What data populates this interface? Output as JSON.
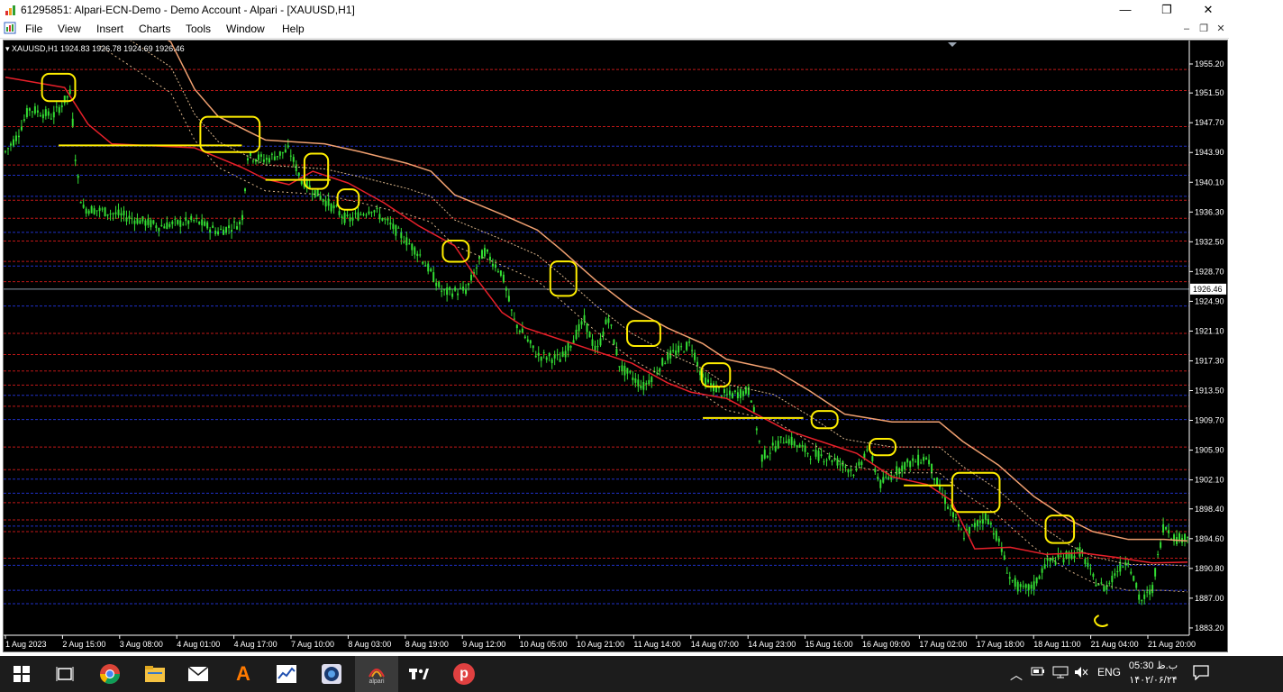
{
  "window": {
    "title": "61295851: Alpari-ECN-Demo - Demo Account - Alpari - [XAUUSD,H1]",
    "minimize": "—",
    "maximize": "❐",
    "close": "✕"
  },
  "menu": {
    "items": [
      "File",
      "View",
      "Insert",
      "Charts",
      "Tools",
      "Window",
      "Help"
    ],
    "mdi_minimize": "–",
    "mdi_restore": "❐",
    "mdi_close": "✕"
  },
  "chart": {
    "header": "XAUUSD,H1  1924.83 1926.78 1924.69 1926.46",
    "symbol": "XAUUSD",
    "timeframe": "H1",
    "current_price": "1926.46",
    "colors": {
      "background": "#000000",
      "candles": "#33dd33",
      "red_line": "#e8202a",
      "orange_line": "#f0a070",
      "dotted_line": "#d9b48a",
      "red_levels": "#c01818",
      "blue_levels": "#2030c8",
      "annotations": "#ffee00",
      "axis_text": "#ffffff"
    }
  },
  "chart_data": {
    "type": "candlestick",
    "price_ticks": [
      "1955.20",
      "1951.50",
      "1947.70",
      "1943.90",
      "1940.10",
      "1936.30",
      "1932.50",
      "1928.70",
      "1924.90",
      "1921.10",
      "1917.30",
      "1913.50",
      "1909.70",
      "1905.90",
      "1902.10",
      "1898.40",
      "1894.60",
      "1890.80",
      "1887.00",
      "1883.20"
    ],
    "time_ticks": [
      "1 Aug 2023",
      "2 Aug 15:00",
      "3 Aug 08:00",
      "4 Aug 01:00",
      "4 Aug 17:00",
      "7 Aug 10:00",
      "8 Aug 03:00",
      "8 Aug 19:00",
      "9 Aug 12:00",
      "10 Aug 05:00",
      "10 Aug 21:00",
      "11 Aug 14:00",
      "14 Aug 07:00",
      "14 Aug 23:00",
      "15 Aug 16:00",
      "16 Aug 09:00",
      "17 Aug 02:00",
      "17 Aug 18:00",
      "18 Aug 11:00",
      "21 Aug 04:00",
      "21 Aug 20:00"
    ],
    "ylim": [
      1882.5,
      1957.5
    ],
    "price_path": [
      [
        0,
        1944.0
      ],
      [
        0.01,
        1946
      ],
      [
        0.02,
        1949.5
      ],
      [
        0.04,
        1948.5
      ],
      [
        0.05,
        1950.5
      ],
      [
        0.055,
        1951.5
      ],
      [
        0.06,
        1942.0
      ],
      [
        0.065,
        1936.8
      ],
      [
        0.08,
        1936.5
      ],
      [
        0.1,
        1935.8
      ],
      [
        0.13,
        1934.5
      ],
      [
        0.16,
        1935.2
      ],
      [
        0.18,
        1933.8
      ],
      [
        0.2,
        1935.0
      ],
      [
        0.205,
        1943.5
      ],
      [
        0.22,
        1943.0
      ],
      [
        0.24,
        1944.2
      ],
      [
        0.25,
        1940.5
      ],
      [
        0.27,
        1937.8
      ],
      [
        0.29,
        1935.2
      ],
      [
        0.31,
        1936.8
      ],
      [
        0.33,
        1934.0
      ],
      [
        0.35,
        1931.0
      ],
      [
        0.37,
        1926.0
      ],
      [
        0.39,
        1926.3
      ],
      [
        0.405,
        1931.4
      ],
      [
        0.42,
        1928.5
      ],
      [
        0.43,
        1922.5
      ],
      [
        0.45,
        1918.0
      ],
      [
        0.47,
        1917.5
      ],
      [
        0.49,
        1922.5
      ],
      [
        0.5,
        1918.2
      ],
      [
        0.51,
        1923.0
      ],
      [
        0.52,
        1916.5
      ],
      [
        0.54,
        1914.0
      ],
      [
        0.56,
        1917.8
      ],
      [
        0.58,
        1919.5
      ],
      [
        0.59,
        1915.0
      ],
      [
        0.61,
        1912.8
      ],
      [
        0.63,
        1913.5
      ],
      [
        0.64,
        1905.0
      ],
      [
        0.66,
        1907.5
      ],
      [
        0.68,
        1905.5
      ],
      [
        0.7,
        1904.8
      ],
      [
        0.72,
        1903.0
      ],
      [
        0.73,
        1906.5
      ],
      [
        0.74,
        1901.5
      ],
      [
        0.76,
        1904.0
      ],
      [
        0.78,
        1905.0
      ],
      [
        0.79,
        1901.0
      ],
      [
        0.8,
        1898.0
      ],
      [
        0.81,
        1895.0
      ],
      [
        0.83,
        1897.5
      ],
      [
        0.84,
        1894.5
      ],
      [
        0.85,
        1889.5
      ],
      [
        0.86,
        1888.0
      ],
      [
        0.87,
        1888.5
      ],
      [
        0.88,
        1891.5
      ],
      [
        0.9,
        1892.5
      ],
      [
        0.91,
        1893.0
      ],
      [
        0.92,
        1889.5
      ],
      [
        0.93,
        1888.2
      ],
      [
        0.94,
        1890.5
      ],
      [
        0.95,
        1892.0
      ],
      [
        0.96,
        1886.5
      ],
      [
        0.97,
        1888.0
      ],
      [
        0.98,
        1896.5
      ],
      [
        0.99,
        1894.5
      ],
      [
        1.0,
        1895.0
      ]
    ],
    "red_line_path": [
      [
        0,
        1953.5
      ],
      [
        0.05,
        1952.2
      ],
      [
        0.07,
        1947.5
      ],
      [
        0.09,
        1945.0
      ],
      [
        0.16,
        1944.5
      ],
      [
        0.2,
        1942.0
      ],
      [
        0.22,
        1940.5
      ],
      [
        0.24,
        1939.8
      ],
      [
        0.26,
        1941.5
      ],
      [
        0.29,
        1940.0
      ],
      [
        0.32,
        1937.5
      ],
      [
        0.35,
        1934.5
      ],
      [
        0.38,
        1932.0
      ],
      [
        0.4,
        1927.5
      ],
      [
        0.42,
        1923.5
      ],
      [
        0.44,
        1921.5
      ],
      [
        0.47,
        1920.0
      ],
      [
        0.5,
        1918.5
      ],
      [
        0.53,
        1917.0
      ],
      [
        0.56,
        1914.5
      ],
      [
        0.58,
        1913.3
      ],
      [
        0.61,
        1912.5
      ],
      [
        0.66,
        1908.5
      ],
      [
        0.69,
        1907.0
      ],
      [
        0.72,
        1905.5
      ],
      [
        0.75,
        1902.5
      ],
      [
        0.78,
        1901.5
      ],
      [
        0.8,
        1899.5
      ],
      [
        0.82,
        1893.3
      ],
      [
        0.85,
        1893.5
      ],
      [
        0.88,
        1892.6
      ],
      [
        0.91,
        1892.8
      ],
      [
        0.94,
        1892.2
      ],
      [
        0.97,
        1891.5
      ],
      [
        1.0,
        1891.6
      ]
    ],
    "orange_line_path": [
      [
        0.08,
        1964.0
      ],
      [
        0.14,
        1958.0
      ],
      [
        0.16,
        1952.0
      ],
      [
        0.18,
        1948.5
      ],
      [
        0.22,
        1945.5
      ],
      [
        0.27,
        1945.0
      ],
      [
        0.3,
        1944.0
      ],
      [
        0.34,
        1942.5
      ],
      [
        0.36,
        1941.5
      ],
      [
        0.38,
        1938.5
      ],
      [
        0.42,
        1936.0
      ],
      [
        0.45,
        1934.0
      ],
      [
        0.47,
        1931.5
      ],
      [
        0.5,
        1927.5
      ],
      [
        0.53,
        1924.0
      ],
      [
        0.56,
        1921.5
      ],
      [
        0.59,
        1919.5
      ],
      [
        0.61,
        1917.5
      ],
      [
        0.65,
        1916.2
      ],
      [
        0.68,
        1913.5
      ],
      [
        0.71,
        1910.5
      ],
      [
        0.75,
        1909.5
      ],
      [
        0.79,
        1909.5
      ],
      [
        0.81,
        1907.0
      ],
      [
        0.84,
        1904.0
      ],
      [
        0.87,
        1900.0
      ],
      [
        0.9,
        1897.0
      ],
      [
        0.92,
        1895.5
      ],
      [
        0.95,
        1894.5
      ],
      [
        0.98,
        1894.5
      ],
      [
        1.0,
        1894.3
      ]
    ],
    "red_levels": [
      1954.5,
      1951.8,
      1947.2,
      1942.3,
      1937.8,
      1935.5,
      1932.6,
      1930.0,
      1927.4,
      1920.8,
      1918.1,
      1916.0,
      1914.2,
      1911.5,
      1906.3,
      1903.4,
      1899.2,
      1897.0,
      1895.5,
      1892.1
    ],
    "blue_levels": [
      1944.7,
      1941.0,
      1938.3,
      1933.7,
      1929.4,
      1924.3,
      1912.9,
      1909.8,
      1902.2,
      1900.4,
      1896.2,
      1891.2,
      1888.0,
      1886.3
    ],
    "current_price_level": 1926.46
  },
  "taskbar": {
    "icons": [
      "windows-start",
      "task-view",
      "chrome",
      "file-explorer",
      "mail",
      "avast",
      "app-chart",
      "app-media",
      "alpari",
      "tradingview",
      "psiphon"
    ],
    "alpari_label": "alpari",
    "tray_lang": "ENG",
    "clock_time": "05:30 ب.ظ",
    "clock_date": "۱۴۰۲/۰۶/۲۴"
  }
}
